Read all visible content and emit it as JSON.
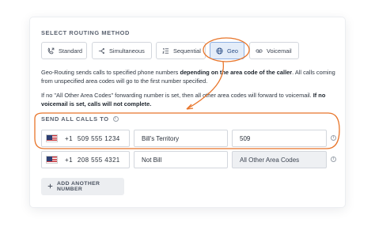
{
  "routing": {
    "section_label": "SELECT ROUTING METHOD",
    "methods": [
      {
        "label": "Standard",
        "icon": "phone-forward-icon",
        "active": false
      },
      {
        "label": "Simultaneous",
        "icon": "split-arrows-icon",
        "active": false
      },
      {
        "label": "Sequential",
        "icon": "numbered-list-icon",
        "active": false
      },
      {
        "label": "Geo",
        "icon": "globe-icon",
        "active": true
      },
      {
        "label": "Voicemail",
        "icon": "voicemail-icon",
        "active": false
      }
    ]
  },
  "description": {
    "p1_start": "Geo-Routing sends calls to specified phone numbers ",
    "p1_bold": "depending on the area code of the caller",
    "p1_end": ". All calls coming from unspecified area codes will go to the first number specified.",
    "p2_start": "If no \"All Other Area Codes\" forwarding number is set, then all other area codes will forward to voicemail. ",
    "p2_bold": "If no voicemail is set, calls will not complete."
  },
  "send_all": {
    "label": "SEND ALL CALLS TO",
    "info_icon": "info-icon"
  },
  "rows": [
    {
      "country_code": "+1",
      "phone": "509 555 1234",
      "name": "Bill's Territory",
      "area_codes": "509",
      "area_disabled": false
    },
    {
      "country_code": "+1",
      "phone": "208 555 4321",
      "name": "Not Bill",
      "area_codes": "All Other Area Codes",
      "area_disabled": true
    }
  ],
  "add_button": {
    "label": "ADD ANOTHER NUMBER",
    "icon": "plus-icon"
  },
  "colors": {
    "accent_highlight": "#e8752a",
    "active_method_bg": "#e4edf9",
    "active_method_border": "#8fb1e3"
  }
}
